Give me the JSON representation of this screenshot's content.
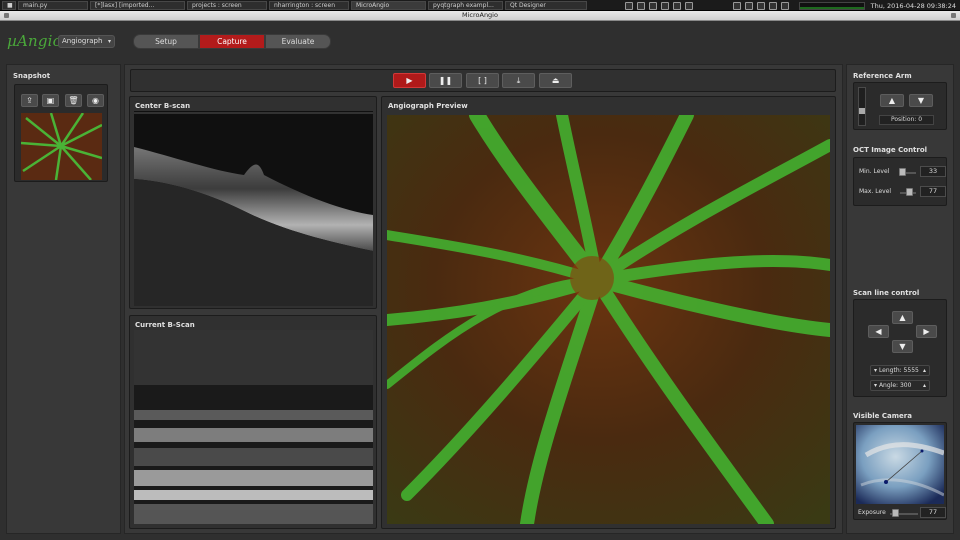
{
  "taskbar": {
    "tasks": [
      "main.py",
      "[*]lasx] [imported...",
      "projects : screen",
      "nharrington : screen",
      "MicroAngio",
      "pyqtgraph exampl...",
      "Qt Designer"
    ],
    "clock": "Thu, 2016-04-28 09:38:24"
  },
  "window": {
    "title": "MicroAngio"
  },
  "header": {
    "brand": "µAngio",
    "mode": "Angiograph",
    "tabs": [
      "Setup",
      "Capture",
      "Evaluate"
    ],
    "active_tab": "Capture"
  },
  "snapshot": {
    "title": "Snapshot"
  },
  "center_bscan": {
    "title": "Center B-scan"
  },
  "current_bscan": {
    "title": "Current B-Scan"
  },
  "angiograph": {
    "title": "Angiograph Preview"
  },
  "reference_arm": {
    "title": "Reference Arm",
    "position_label": "Position: 0"
  },
  "oct_control": {
    "title": "OCT Image Control",
    "min_label": "Min. Level",
    "min_value": "33",
    "max_label": "Max. Level",
    "max_value": "77"
  },
  "scan_line": {
    "title": "Scan line control",
    "length_label": "Length: 5555",
    "angle_label": "Angle: 300"
  },
  "camera": {
    "title": "Visible Camera",
    "exposure_label": "Exposure",
    "exposure_value": "77"
  },
  "colors": {
    "accent": "#b31b1b",
    "brand": "#4aa83a"
  }
}
